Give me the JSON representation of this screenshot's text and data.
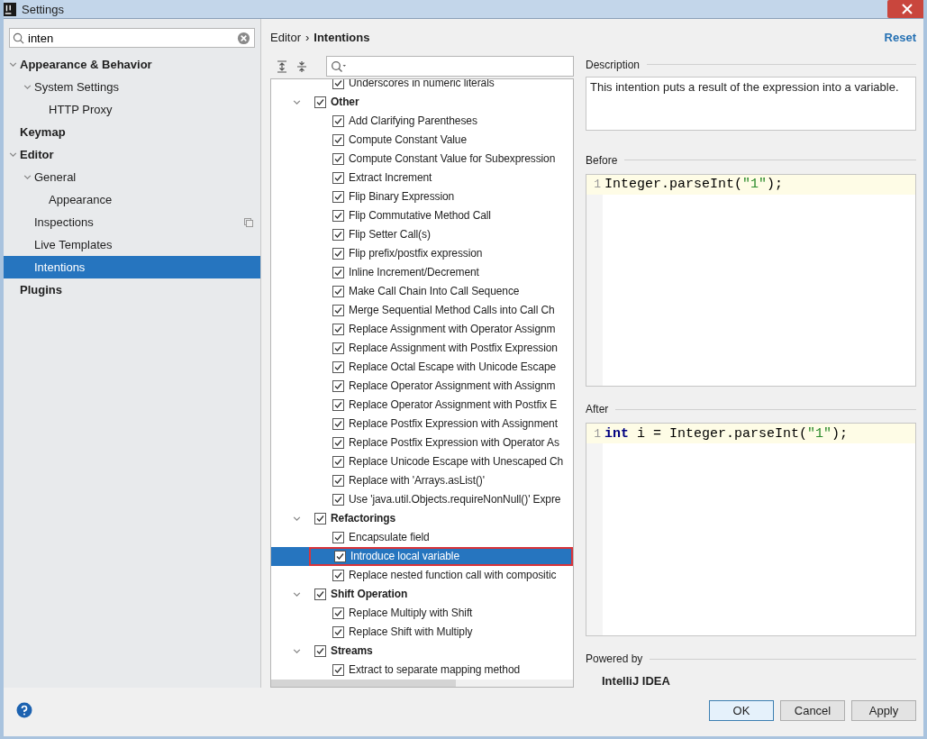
{
  "window": {
    "title": "Settings"
  },
  "sidebar": {
    "search": {
      "value": "inten"
    },
    "items": [
      {
        "label": "Appearance & Behavior",
        "expanded": true,
        "selected": false,
        "scope_icon": false,
        "children": [
          {
            "label": "System Settings",
            "expanded": true,
            "selected": false,
            "scope_icon": false,
            "children": [
              {
                "label": "HTTP Proxy",
                "selected": false,
                "scope_icon": false
              }
            ]
          }
        ]
      },
      {
        "label": "Keymap",
        "selected": false,
        "scope_icon": false
      },
      {
        "label": "Editor",
        "expanded": true,
        "selected": false,
        "scope_icon": false,
        "children": [
          {
            "label": "General",
            "expanded": true,
            "selected": false,
            "scope_icon": false,
            "children": [
              {
                "label": "Appearance",
                "selected": false,
                "scope_icon": false
              }
            ]
          },
          {
            "label": "Inspections",
            "selected": false,
            "scope_icon": true
          },
          {
            "label": "Live Templates",
            "selected": false,
            "scope_icon": false
          },
          {
            "label": "Intentions",
            "selected": true,
            "scope_icon": false
          }
        ]
      },
      {
        "label": "Plugins",
        "selected": false,
        "scope_icon": false
      }
    ]
  },
  "header": {
    "breadcrumb": [
      "Editor",
      "Intentions"
    ],
    "separator": "›",
    "reset": "Reset"
  },
  "intentions": [
    {
      "kind": "item",
      "label": "Underscores in numeric literals",
      "checked": true,
      "selected": false
    },
    {
      "kind": "group",
      "label": "Other",
      "checked": true,
      "expanded": true,
      "selected": false,
      "children": [
        {
          "label": "Add Clarifying Parentheses",
          "checked": true,
          "selected": false
        },
        {
          "label": "Compute Constant Value",
          "checked": true,
          "selected": false
        },
        {
          "label": "Compute Constant Value for Subexpression",
          "checked": true,
          "selected": false
        },
        {
          "label": "Extract Increment",
          "checked": true,
          "selected": false
        },
        {
          "label": "Flip Binary Expression",
          "checked": true,
          "selected": false
        },
        {
          "label": "Flip Commutative Method Call",
          "checked": true,
          "selected": false
        },
        {
          "label": "Flip Setter Call(s)",
          "checked": true,
          "selected": false
        },
        {
          "label": "Flip prefix/postfix expression",
          "checked": true,
          "selected": false
        },
        {
          "label": "Inline Increment/Decrement",
          "checked": true,
          "selected": false
        },
        {
          "label": "Make Call Chain Into Call Sequence",
          "checked": true,
          "selected": false
        },
        {
          "label": "Merge Sequential Method Calls into Call Ch",
          "checked": true,
          "selected": false
        },
        {
          "label": "Replace Assignment with Operator Assignm",
          "checked": true,
          "selected": false
        },
        {
          "label": "Replace Assignment with Postfix Expression",
          "checked": true,
          "selected": false
        },
        {
          "label": "Replace Octal Escape with Unicode Escape",
          "checked": true,
          "selected": false
        },
        {
          "label": "Replace Operator Assignment with Assignm",
          "checked": true,
          "selected": false
        },
        {
          "label": "Replace Operator Assignment with Postfix E",
          "checked": true,
          "selected": false
        },
        {
          "label": "Replace Postfix Expression with Assignment",
          "checked": true,
          "selected": false
        },
        {
          "label": "Replace Postfix Expression with Operator As",
          "checked": true,
          "selected": false
        },
        {
          "label": "Replace Unicode Escape with Unescaped Ch",
          "checked": true,
          "selected": false
        },
        {
          "label": "Replace with 'Arrays.asList()'",
          "checked": true,
          "selected": false
        },
        {
          "label": "Use 'java.util.Objects.requireNonNull()' Expre",
          "checked": true,
          "selected": false
        }
      ]
    },
    {
      "kind": "group",
      "label": "Refactorings",
      "checked": true,
      "expanded": true,
      "selected": false,
      "children": [
        {
          "label": "Encapsulate field",
          "checked": true,
          "selected": false
        },
        {
          "label": "Introduce local variable",
          "checked": true,
          "selected": true
        },
        {
          "label": "Replace nested function call with compositic",
          "checked": true,
          "selected": false
        }
      ]
    },
    {
      "kind": "group",
      "label": "Shift Operation",
      "checked": true,
      "expanded": true,
      "selected": false,
      "children": [
        {
          "label": "Replace Multiply with Shift",
          "checked": true,
          "selected": false
        },
        {
          "label": "Replace Shift with Multiply",
          "checked": true,
          "selected": false
        }
      ]
    },
    {
      "kind": "group",
      "label": "Streams",
      "checked": true,
      "expanded": true,
      "selected": false,
      "children": [
        {
          "label": "Extract to separate mapping method",
          "checked": true,
          "selected": false
        }
      ]
    }
  ],
  "description": {
    "label": "Description",
    "text": "This intention puts a result of the expression into a variable."
  },
  "before": {
    "label": "Before",
    "line_number": "1",
    "tokens": [
      {
        "kind": "plain",
        "text": "Integer.parseInt("
      },
      {
        "kind": "string",
        "text": "\"1\""
      },
      {
        "kind": "plain",
        "text": ");"
      }
    ]
  },
  "after": {
    "label": "After",
    "line_number": "1",
    "tokens": [
      {
        "kind": "keyword",
        "text": "int"
      },
      {
        "kind": "plain",
        "text": " i = Integer.parseInt("
      },
      {
        "kind": "string",
        "text": "\"1\""
      },
      {
        "kind": "plain",
        "text": ");"
      }
    ]
  },
  "powered_by": {
    "label": "Powered by",
    "name": "IntelliJ IDEA"
  },
  "buttons": [
    {
      "label": "OK",
      "default": true
    },
    {
      "label": "Cancel",
      "default": false
    },
    {
      "label": "Apply",
      "default": false
    }
  ]
}
